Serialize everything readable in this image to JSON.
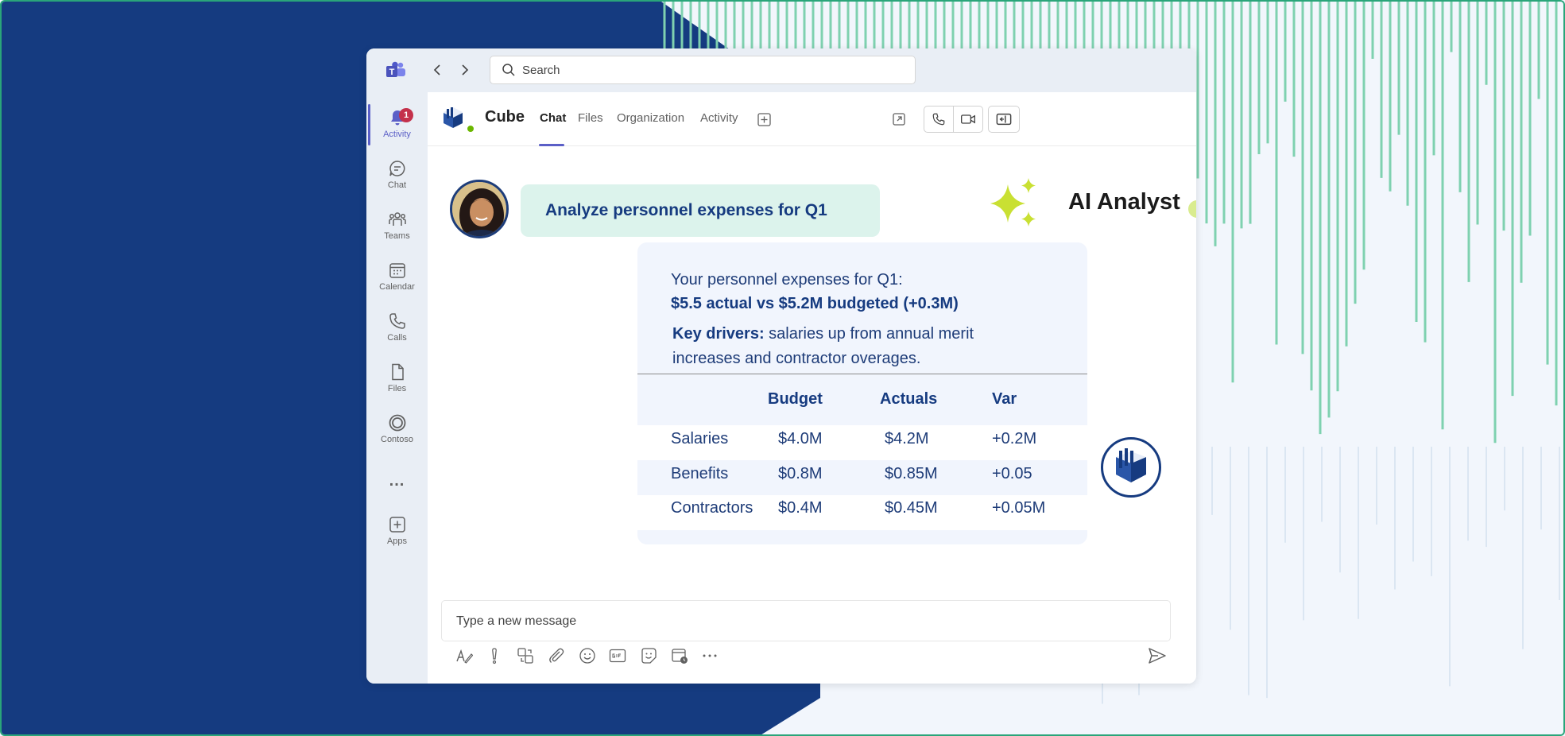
{
  "search": {
    "placeholder": "Search"
  },
  "rail": {
    "badge_count": "1",
    "items": [
      {
        "label": "Activity"
      },
      {
        "label": "Chat"
      },
      {
        "label": "Teams"
      },
      {
        "label": "Calendar"
      },
      {
        "label": "Calls"
      },
      {
        "label": "Files"
      },
      {
        "label": "Contoso"
      },
      {
        "label": "..."
      },
      {
        "label": "Apps"
      }
    ]
  },
  "header": {
    "app_name": "Cube",
    "tabs": [
      {
        "label": "Chat"
      },
      {
        "label": "Files"
      },
      {
        "label": "Organization"
      },
      {
        "label": "Activity"
      }
    ]
  },
  "conversation": {
    "user_message": "Analyze personnel expenses for Q1",
    "ai_name": "AI Analyst",
    "response": {
      "line1": "Your personnel expenses for Q1:",
      "line2": "$5.5 actual vs $5.2M budgeted (+0.3M)",
      "drivers_label": "Key drivers:",
      "drivers_text": " salaries up from annual merit increases and contractor overages."
    },
    "table": {
      "headers": [
        "Budget",
        "Actuals",
        "Var"
      ],
      "rows": [
        {
          "label": "Salaries",
          "budget": "$4.0M",
          "actuals": "$4.2M",
          "var": "+0.2M"
        },
        {
          "label": "Benefits",
          "budget": "$0.8M",
          "actuals": "$0.85M",
          "var": "+0.05"
        },
        {
          "label": "Contractors",
          "budget": "$0.4M",
          "actuals": "$0.45M",
          "var": "+0.05M"
        }
      ]
    }
  },
  "compose": {
    "placeholder": "Type a new message"
  },
  "colors": {
    "navy": "#153b80",
    "accent": "#5b5fc7",
    "stripe": "#7fd1b0",
    "sparkle": "#c9e033",
    "bubble": "#dcf3ec"
  }
}
